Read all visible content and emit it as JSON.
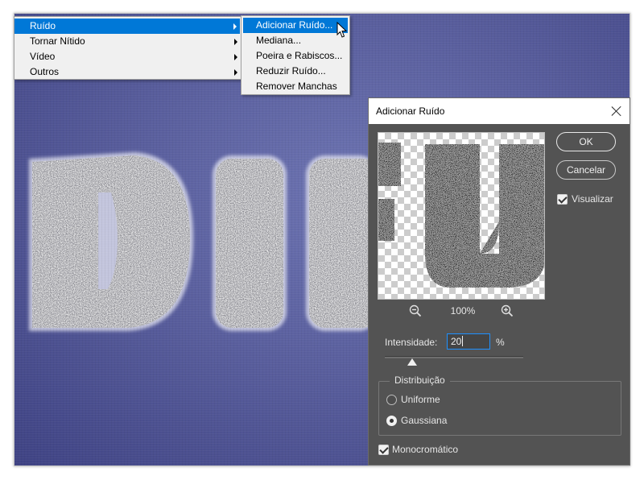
{
  "filter_menu": {
    "items": [
      {
        "label": "Ruído",
        "active": true
      },
      {
        "label": "Tornar Nítido",
        "active": false
      },
      {
        "label": "Vídeo",
        "active": false
      },
      {
        "label": "Outros",
        "active": false
      }
    ]
  },
  "noise_submenu": {
    "items": [
      {
        "label": "Adicionar Ruído...",
        "active": true
      },
      {
        "label": "Mediana...",
        "active": false
      },
      {
        "label": "Poeira e Rabiscos...",
        "active": false
      },
      {
        "label": "Reduzir Ruído...",
        "active": false
      },
      {
        "label": "Remover Manchas",
        "active": false
      }
    ]
  },
  "dialog": {
    "title": "Adicionar Ruído",
    "ok_label": "OK",
    "cancel_label": "Cancelar",
    "preview_label": "Visualizar",
    "preview_checked": true,
    "zoom_level": "100%",
    "amount_label": "Intensidade:",
    "amount_value": "20",
    "amount_unit": "%",
    "amount_slider_fraction": 0.2,
    "distribution": {
      "legend": "Distribuição",
      "options": [
        {
          "label": "Uniforme",
          "selected": false
        },
        {
          "label": "Gaussiana",
          "selected": true
        }
      ]
    },
    "monochromatic_label": "Monocromático",
    "monochromatic_checked": true
  },
  "icons": {
    "close": "close-icon",
    "zoom_out": "zoom-out-icon",
    "zoom_in": "zoom-in-icon",
    "cursor": "arrow-cursor-icon"
  },
  "colors": {
    "menu_highlight": "#0078d7",
    "dialog_bg": "#535353",
    "canvas_blue": "#5a5f9e",
    "input_focus": "#1e90ff"
  }
}
